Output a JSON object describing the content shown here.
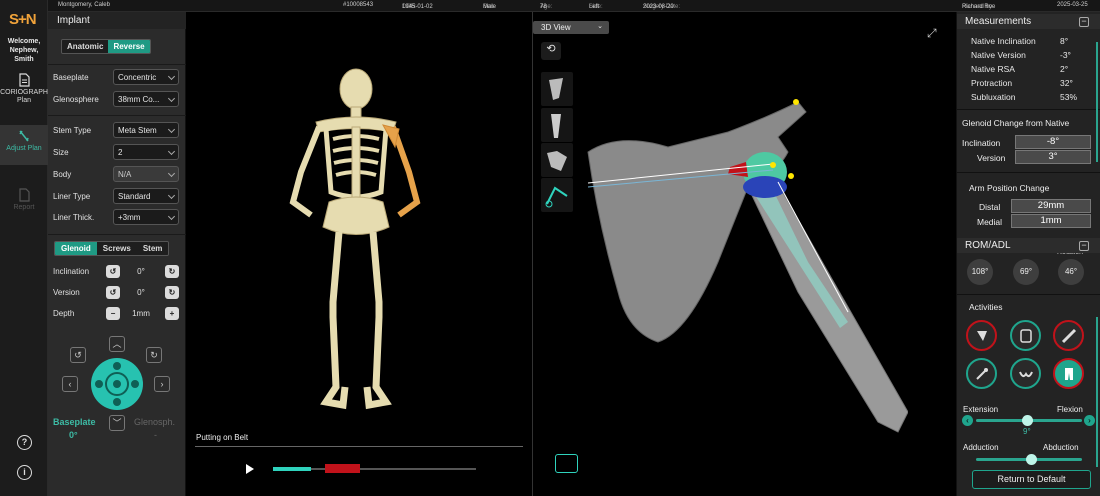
{
  "patient": {
    "name": "Montgomery, Caleb",
    "id": "#10008543",
    "dob_label": "DOB:",
    "dob": "1945-01-02",
    "sex_label": "Sex:",
    "sex": "Male",
    "age_label": "Age:",
    "age": "78",
    "side_label": "Side:",
    "side": "Left",
    "surgery_label": "Surgery Date:",
    "surgery": "2023-08-20",
    "planned_label": "Planned by:",
    "planned": "Richard Roe",
    "date": "2025-03-25"
  },
  "nav": {
    "logo": "S+N",
    "welcome": "Welcome, Nephew, Smith",
    "plan": "CORIOGRAPH Plan",
    "adjust": "Adjust Plan",
    "report": "Report",
    "help_glyph": "?",
    "info_glyph": "i"
  },
  "implant": {
    "title": "Implant",
    "toggle": [
      "Anatomic",
      "Reverse"
    ],
    "rows": [
      {
        "label": "Baseplate",
        "value": "Concentric"
      },
      {
        "label": "Glenosphere",
        "value": "38mm Co..."
      },
      {
        "label": "Stem Type",
        "value": "Meta Stem"
      },
      {
        "label": "Size",
        "value": "2"
      },
      {
        "label": "Body",
        "value": "N/A"
      },
      {
        "label": "Liner Type",
        "value": "Standard"
      },
      {
        "label": "Liner Thick.",
        "value": "+3mm"
      }
    ],
    "tabs": [
      "Glenoid",
      "Screws",
      "Stem"
    ],
    "adjust": [
      {
        "label": "Inclination",
        "value": "0°"
      },
      {
        "label": "Version",
        "value": "0°"
      },
      {
        "label": "Depth",
        "value": "1mm"
      }
    ],
    "baseplate_label": "Baseplate",
    "baseplate_value": "0°",
    "glenosphere_label": "Glenosph.",
    "glenosphere_value": "-"
  },
  "viewer2d": {
    "animation": "Putting on Belt",
    "progress": 0.36
  },
  "viewer3d": {
    "view_select": "3D View"
  },
  "measurements": {
    "title": "Measurements",
    "items": [
      {
        "label": "Native Inclination",
        "value": "8°"
      },
      {
        "label": "Native Version",
        "value": "-3°"
      },
      {
        "label": "Native RSA",
        "value": "2°"
      },
      {
        "label": "Protraction",
        "value": "32°"
      },
      {
        "label": "Subluxation",
        "value": "53%"
      }
    ],
    "glenoid_change_title": "Glenoid Change from Native",
    "inclination_label": "Inclination",
    "inclination": "-8°",
    "version_label": "Version",
    "version": "3°",
    "arm_title": "Arm Position Change",
    "distal_label": "Distal",
    "distal": "29mm",
    "medial_label": "Medial",
    "medial": "1mm"
  },
  "rom": {
    "title": "ROM/ADL",
    "rotation_label": "Rotation",
    "values": [
      "108°",
      "69°",
      "46°"
    ],
    "activities_title": "Activities",
    "ext_label": "Extension",
    "flex_label": "Flexion",
    "ext_value": "9°",
    "abd_label": "Adduction",
    "abd2_label": "Abduction",
    "return_button": "Return to Default"
  },
  "colors": {
    "accent": "#1fa58d",
    "orange": "#f1a33a",
    "red": "#c1121a"
  }
}
